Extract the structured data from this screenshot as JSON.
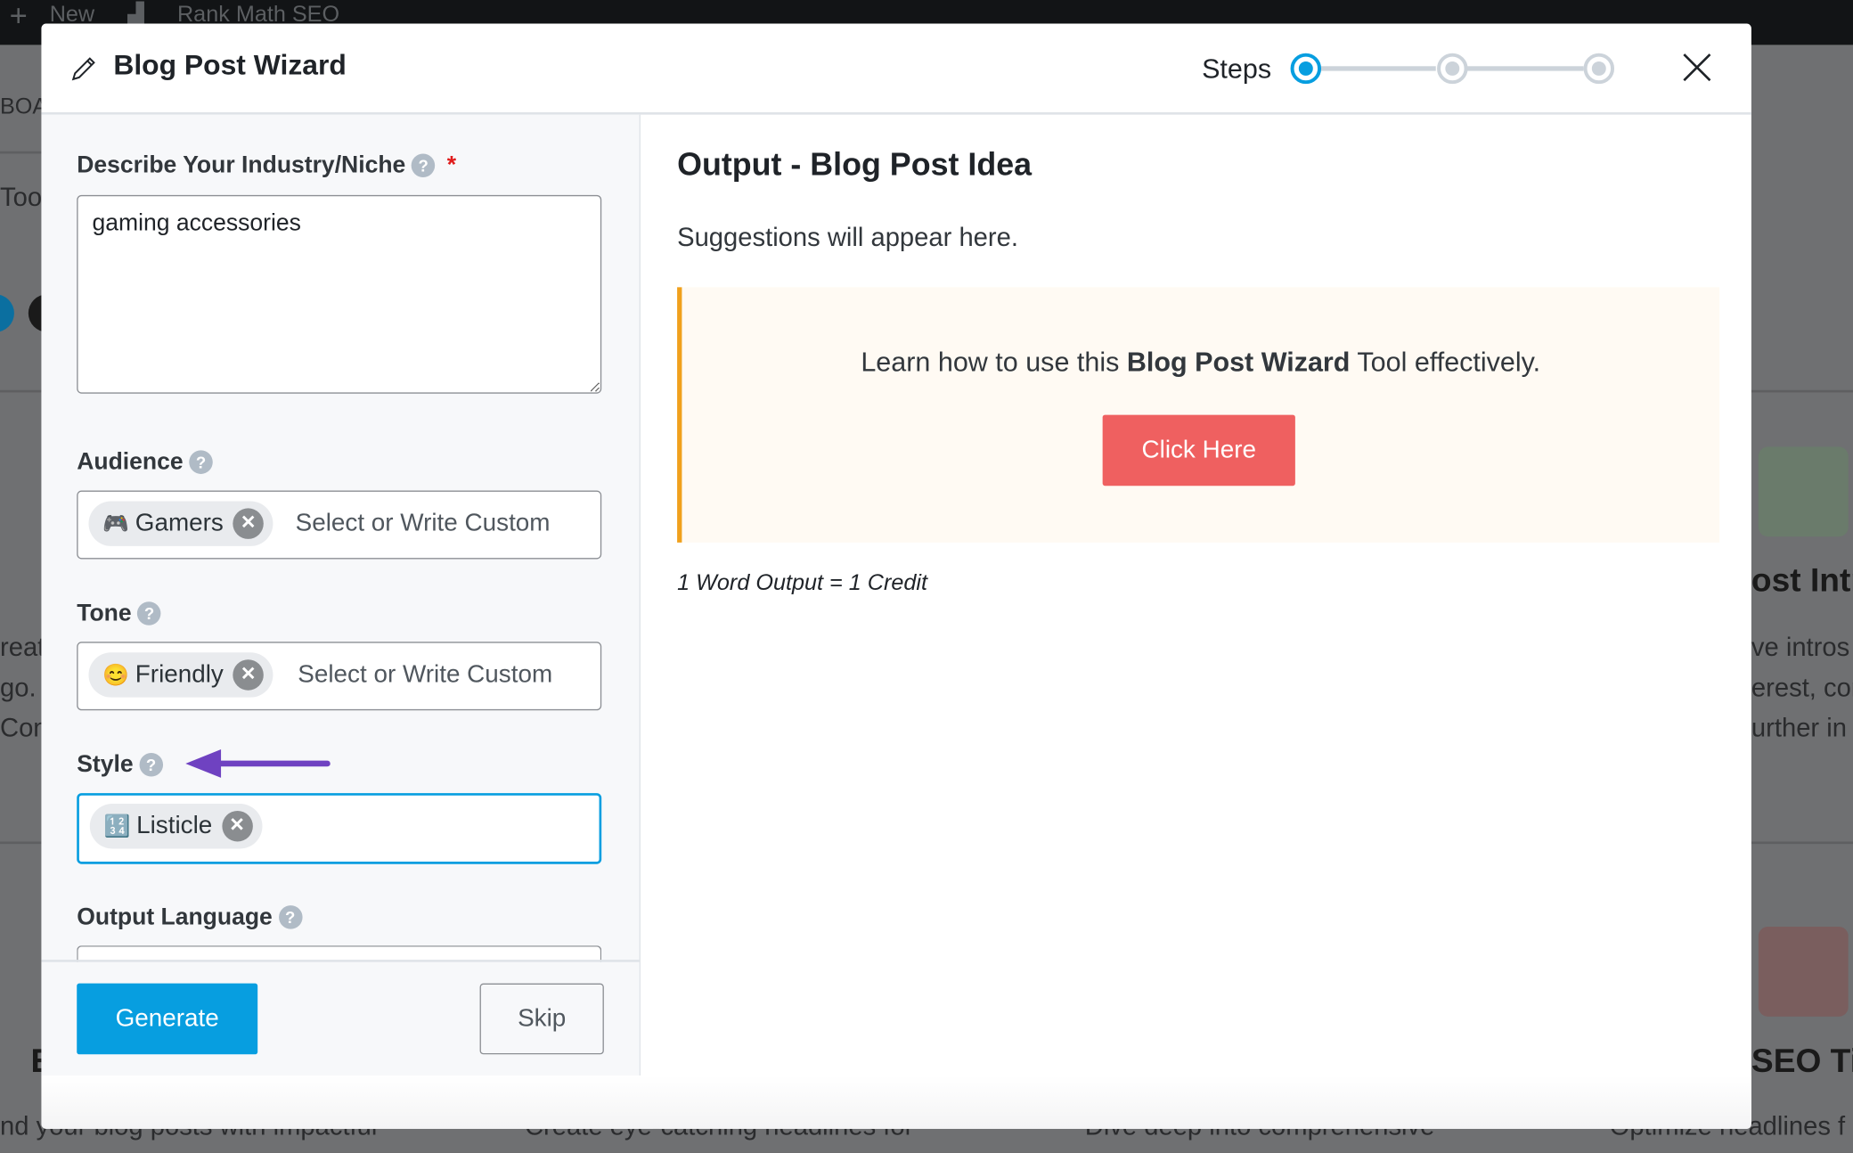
{
  "background": {
    "adminbar": {
      "new_label": "New",
      "plugin_label": "Rank Math SEO"
    },
    "fragments": [
      "BOA",
      "Too",
      "reat",
      "go.",
      "Con",
      "E",
      "nd your blog posts with impactful",
      "Create eye-catching headlines for",
      "Dive deep into comprehensive",
      "Optimize headlines f",
      "ost Intro",
      "ve intros",
      "erest, cor",
      "urther in",
      "SEO Tit"
    ]
  },
  "modal": {
    "title": "Blog Post Wizard",
    "steps_label": "Steps",
    "steps_total": 3,
    "current_step": 1,
    "accent_color": "#079ee0"
  },
  "form": {
    "industry": {
      "label": "Describe Your Industry/Niche",
      "required_mark": "*",
      "help": "?",
      "value": "gaming accessories"
    },
    "audience": {
      "label": "Audience",
      "help": "?",
      "chip": {
        "emoji": "🎮",
        "text": "Gamers"
      },
      "placeholder": "Select or Write Custom"
    },
    "tone": {
      "label": "Tone",
      "help": "?",
      "chip": {
        "emoji": "😊",
        "text": "Friendly"
      },
      "placeholder": "Select or Write Custom"
    },
    "style": {
      "label": "Style",
      "help": "?",
      "chip": {
        "emoji": "🔢",
        "text": "Listicle"
      }
    },
    "language": {
      "label": "Output Language",
      "help": "?"
    },
    "generate_label": "Generate",
    "skip_label": "Skip"
  },
  "output": {
    "title": "Output - Blog Post Idea",
    "suggestions": "Suggestions will appear here.",
    "notice": {
      "before": "Learn how to use this ",
      "bold": "Blog Post Wizard",
      "after": " Tool effectively.",
      "button": "Click Here",
      "button_color": "#ef6060"
    },
    "credit_note": "1 Word Output = 1 Credit"
  },
  "annotation": {
    "arrow_color": "#6f42c1"
  }
}
